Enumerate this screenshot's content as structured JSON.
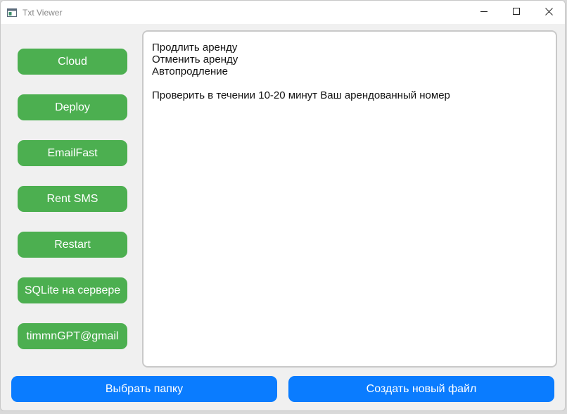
{
  "window": {
    "title": "Txt Viewer"
  },
  "sidebar": {
    "items": [
      {
        "label": "Cloud"
      },
      {
        "label": "Deploy"
      },
      {
        "label": "EmailFast"
      },
      {
        "label": "Rent SMS"
      },
      {
        "label": "Restart"
      },
      {
        "label": "SQLite на сервере"
      },
      {
        "label": "timmnGPT@gmail"
      }
    ]
  },
  "content": {
    "lines": [
      "Продлить аренду",
      "Отменить аренду",
      "Автопродление",
      "",
      "Проверить в течении 10-20 минут Ваш арендованный номер"
    ]
  },
  "footer": {
    "choose_folder_label": "Выбрать папку",
    "create_file_label": "Создать новый файл"
  },
  "colors": {
    "sidebar_button": "#4caf50",
    "footer_button": "#0a7cff",
    "window_bg": "#f0f0f0"
  },
  "icons": {
    "app": "app-window-icon",
    "minimize": "minimize-icon",
    "maximize": "maximize-icon",
    "close": "close-icon"
  }
}
